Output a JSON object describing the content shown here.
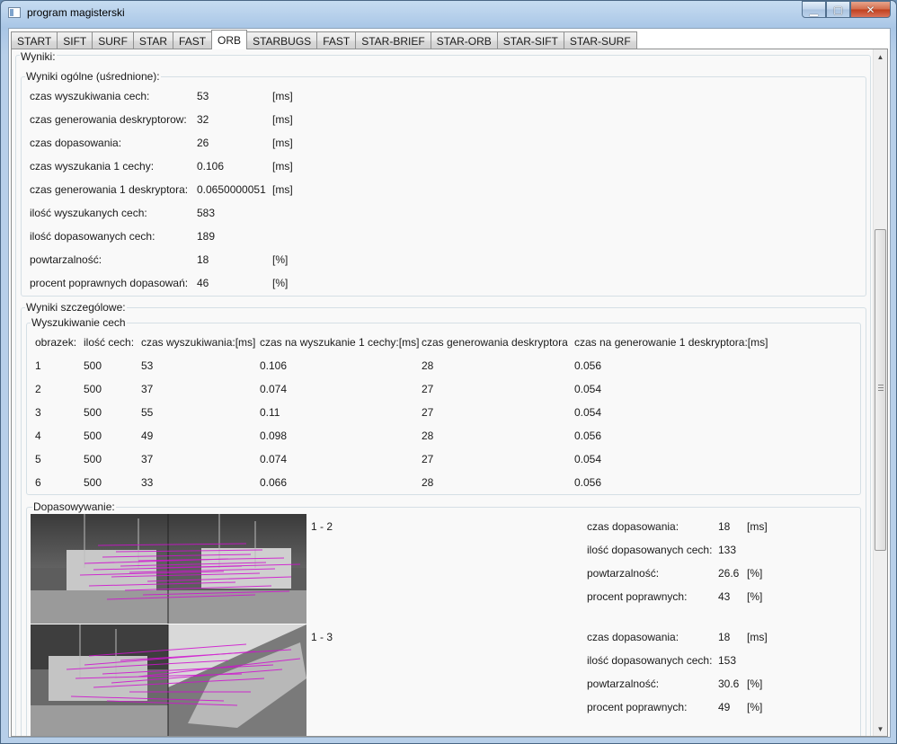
{
  "window": {
    "title": "program magisterski"
  },
  "tabs": [
    "START",
    "SIFT",
    "SURF",
    "STAR",
    "FAST",
    "ORB",
    "STARBUGS",
    "FAST",
    "STAR-BRIEF",
    "STAR-ORB",
    "STAR-SIFT",
    "STAR-SURF"
  ],
  "active_tab_index": 5,
  "results": {
    "label": "Wyniki:",
    "general": {
      "label": "Wyniki ogólne (uśrednione):",
      "rows": [
        {
          "label": "czas wyszukiwania cech:",
          "value": "53",
          "unit": "[ms]"
        },
        {
          "label": "czas generowania deskryptorow:",
          "value": "32",
          "unit": "[ms]"
        },
        {
          "label": "czas dopasowania:",
          "value": "26",
          "unit": "[ms]"
        },
        {
          "label": "czas wyszukania 1 cechy:",
          "value": "0.106",
          "unit": "[ms]"
        },
        {
          "label": "czas generowania 1 deskryptora:",
          "value": "0.0650000051",
          "unit": "[ms]"
        },
        {
          "label": "ilość wyszukanych cech:",
          "value": "583",
          "unit": ""
        },
        {
          "label": "ilość dopasowanych cech:",
          "value": "189",
          "unit": ""
        },
        {
          "label": "powtarzalność:",
          "value": "18",
          "unit": "[%]"
        },
        {
          "label": "procent poprawnych dopasowań:",
          "value": "46",
          "unit": "[%]"
        }
      ]
    },
    "detailed": {
      "label": "Wyniki szczególowe:",
      "detection": {
        "label": "Wyszukiwanie cech",
        "headers": [
          "obrazek:",
          "ilość cech:",
          "czas wyszukiwania:[ms]",
          "czas na wyszukanie 1 cechy:[ms]",
          "czas generowania deskryptora",
          "czas na generowanie 1 deskryptora:[ms]"
        ],
        "rows": [
          [
            "1",
            "500",
            "53",
            "0.106",
            "28",
            "0.056"
          ],
          [
            "2",
            "500",
            "37",
            "0.074",
            "27",
            "0.054"
          ],
          [
            "3",
            "500",
            "55",
            "0.11",
            "27",
            "0.054"
          ],
          [
            "4",
            "500",
            "49",
            "0.098",
            "28",
            "0.056"
          ],
          [
            "5",
            "500",
            "37",
            "0.074",
            "27",
            "0.054"
          ],
          [
            "6",
            "500",
            "33",
            "0.066",
            "28",
            "0.056"
          ]
        ]
      },
      "matching": {
        "label": "Dopasowywanie:",
        "pairs": [
          {
            "pair": "1 - 2",
            "stats": [
              {
                "label": "czas dopasowania:",
                "value": "18",
                "unit": "[ms]"
              },
              {
                "label": "ilość dopasowanych cech:",
                "value": "133",
                "unit": ""
              },
              {
                "label": "powtarzalność:",
                "value": "26.6",
                "unit": "[%]"
              },
              {
                "label": "procent poprawnych:",
                "value": "43",
                "unit": "[%]"
              }
            ]
          },
          {
            "pair": "1 - 3",
            "stats": [
              {
                "label": "czas dopasowania:",
                "value": "18",
                "unit": "[ms]"
              },
              {
                "label": "ilość dopasowanych cech:",
                "value": "153",
                "unit": ""
              },
              {
                "label": "powtarzalność:",
                "value": "30.6",
                "unit": "[%]"
              },
              {
                "label": "procent poprawnych:",
                "value": "49",
                "unit": "[%]"
              }
            ]
          }
        ]
      }
    }
  }
}
